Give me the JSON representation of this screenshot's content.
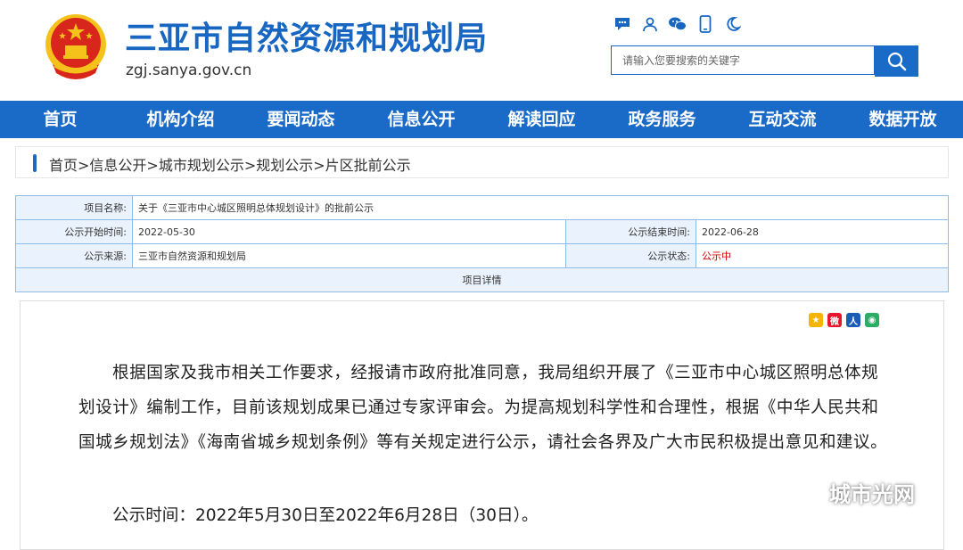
{
  "header": {
    "site_title": "三亚市自然资源和规划局",
    "site_domain": "zgj.sanya.gov.cn",
    "search_placeholder": "请输入您要搜索的关键字",
    "tool_icons": [
      "chat-icon",
      "user-icon",
      "wechat-icon",
      "mobile-icon",
      "night-mode-icon"
    ],
    "emblem_colors": {
      "red": "#d8261d",
      "gold": "#f4c21b"
    }
  },
  "nav": {
    "items": [
      "首页",
      "机构介绍",
      "要闻动态",
      "信息公开",
      "解读回应",
      "政务服务",
      "互动交流",
      "数据开放"
    ]
  },
  "breadcrumb": "首页>信息公开>城市规划公示>规划公示>片区批前公示",
  "info": {
    "project_name_label": "项目名称:",
    "project_name": "关于《三亚市中心城区照明总体规划设计》的批前公示",
    "start_label": "公示开始时间:",
    "start_date": "2022-05-30",
    "end_label": "公示结束时间:",
    "end_date": "2022-06-28",
    "source_label": "公示来源:",
    "source": "三亚市自然资源和规划局",
    "status_label": "公示状态:",
    "status": "公示中",
    "detail_header": "项目详情"
  },
  "content": {
    "paragraph": "根据国家及我市相关工作要求，经报请市政府批准同意，我局组织开展了《三亚市中心城区照明总体规划设计》编制工作，目前该规划成果已通过专家评审会。为提高规划科学性和合理性，根据《中华人民共和国城乡规划法》《海南省城乡规划条例》等有关规定进行公示，请社会各界及广大市民积极提出意见和建议。",
    "time_line": "公示时间：2022年5月30日至2022年6月28日（30日）。",
    "share_icons": [
      "qzone-icon",
      "weibo-icon",
      "renren-icon",
      "wechat-share-icon"
    ]
  },
  "watermark": "城市光网",
  "colors": {
    "brand_blue": "#1a6ac8",
    "title_blue": "#1766c2",
    "table_border": "#8fbbe8",
    "label_bg": "#eaf3fd",
    "status_red": "#d60000"
  }
}
